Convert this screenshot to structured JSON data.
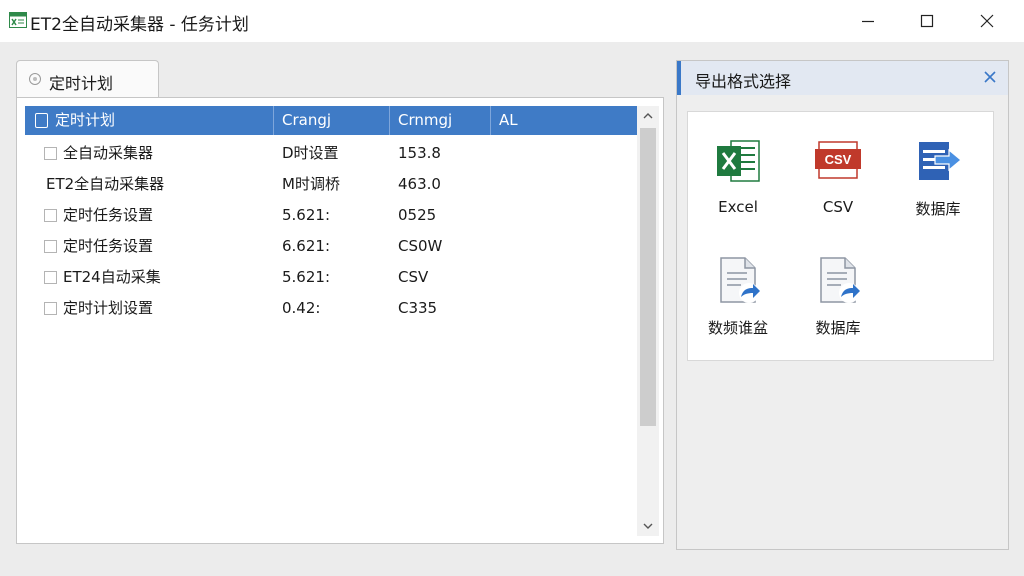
{
  "window": {
    "title": "ET2全自动采集器 - 任务计划",
    "app_icon": "spreadsheet-app-icon",
    "controls": [
      "minimize-icon",
      "maximize-icon",
      "close-icon"
    ]
  },
  "tabs": [
    {
      "label": "定时计划",
      "icon": "clock-icon",
      "selected": true
    }
  ],
  "list": {
    "columns": [
      "定时计划",
      "Crangj",
      "Crnmgj",
      "AL"
    ],
    "rows": [
      {
        "name": "全自动采集器",
        "col1": "D时设置",
        "col2": "153.8",
        "checkbox": true
      },
      {
        "name": "ET2全自动采集器",
        "col1": "M时调桥",
        "col2": "463.0",
        "checkbox": false
      },
      {
        "name": "定时任务设置",
        "col1": "5.621:",
        "col2": "0525",
        "checkbox": true
      },
      {
        "name": "定时任务设置",
        "col1": "6.621:",
        "col2": "CS0W",
        "checkbox": true
      },
      {
        "name": "ET24自动采集",
        "col1": "5.621:",
        "col2": "CSV",
        "checkbox": true
      },
      {
        "name": "定时计划设置",
        "col1": "0.42:",
        "col2": "C335",
        "checkbox": true
      }
    ]
  },
  "export_panel": {
    "title": "导出格式选择",
    "close_icon": "close-icon",
    "formats": [
      {
        "label": "Excel",
        "icon": "excel-icon"
      },
      {
        "label": "CSV",
        "icon": "csv-icon"
      },
      {
        "label": "数据库",
        "icon": "database-export-icon"
      },
      {
        "label": "数频谁盆",
        "icon": "document-export-icon"
      },
      {
        "label": "数据库",
        "icon": "document-export-icon"
      }
    ]
  },
  "colors": {
    "accent": "#3f7bc6",
    "excel_green": "#1f7a3f",
    "csv_red": "#c0392b",
    "export_arrow_blue": "#2f73c9"
  }
}
